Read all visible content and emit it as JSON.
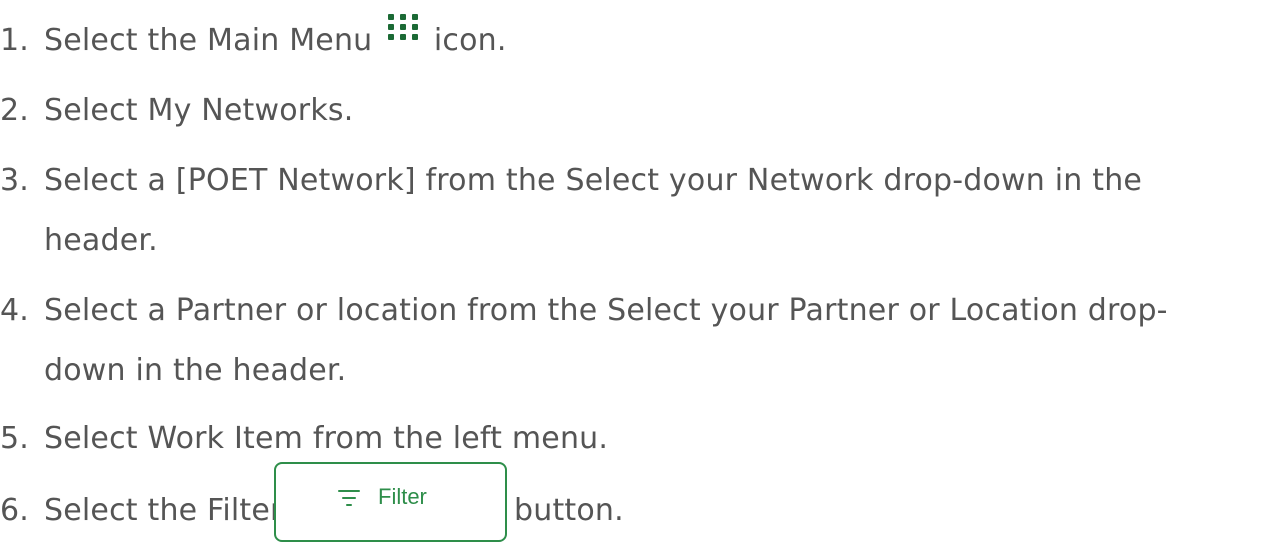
{
  "steps": [
    {
      "number": "1.",
      "before_icon": "Select the Main Menu",
      "icon": "main-menu-grid-icon",
      "after_icon": "icon."
    },
    {
      "number": "2.",
      "text": "Select My Networks."
    },
    {
      "number": "3.",
      "line1": "Select a [POET Network] from the Select your Network drop-down in the",
      "line2": "header."
    },
    {
      "number": "4.",
      "line1": "Select a Partner or location from the Select your Partner or Location drop-",
      "line2": "down in the header."
    },
    {
      "number": "5.",
      "text": "Select Work Item from the left menu."
    },
    {
      "number": "6.",
      "before_button": "Select the Filter",
      "after_button": "button."
    }
  ],
  "filter_button": {
    "label": "Filter",
    "icon": "filter-icon"
  },
  "colors": {
    "text": "#555555",
    "icon_green": "#1b6a35",
    "button_green": "#2e8e4a"
  }
}
